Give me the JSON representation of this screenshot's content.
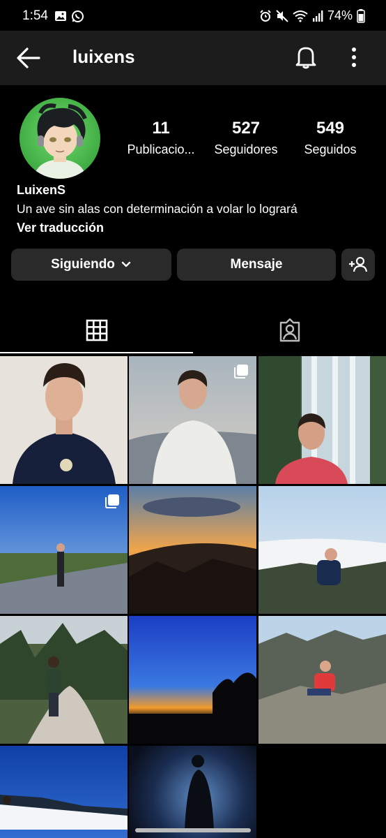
{
  "status_bar": {
    "time": "1:54",
    "battery": "74%"
  },
  "header": {
    "username": "luixens"
  },
  "profile": {
    "stats": [
      {
        "value": "11",
        "label": "Publicacio..."
      },
      {
        "value": "527",
        "label": "Seguidores"
      },
      {
        "value": "549",
        "label": "Seguidos"
      }
    ],
    "display_name": "LuixenS",
    "bio": "Un ave sin alas con determinación a volar lo logrará",
    "translate": "Ver traducción"
  },
  "actions": {
    "following": "Siguiendo",
    "message": "Mensaje"
  },
  "tabs": [
    {
      "icon": "grid-icon",
      "active": true
    },
    {
      "icon": "tagged-icon",
      "active": false
    }
  ],
  "posts": [
    {
      "description": "portrait-dark-jersey",
      "multi": false
    },
    {
      "description": "portrait-white-sweater",
      "multi": true
    },
    {
      "description": "waterfall-portrait",
      "multi": false
    },
    {
      "description": "path-blue-sky",
      "multi": true
    },
    {
      "description": "sunset-clouds",
      "multi": false
    },
    {
      "description": "sitting-above-clouds",
      "multi": false
    },
    {
      "description": "forest-trail",
      "multi": false
    },
    {
      "description": "blue-orange-sunset",
      "multi": false
    },
    {
      "description": "mountain-red-shirt",
      "multi": false
    },
    {
      "description": "snow-blue-sky",
      "multi": false
    },
    {
      "description": "dark-silhouette",
      "multi": false
    }
  ]
}
